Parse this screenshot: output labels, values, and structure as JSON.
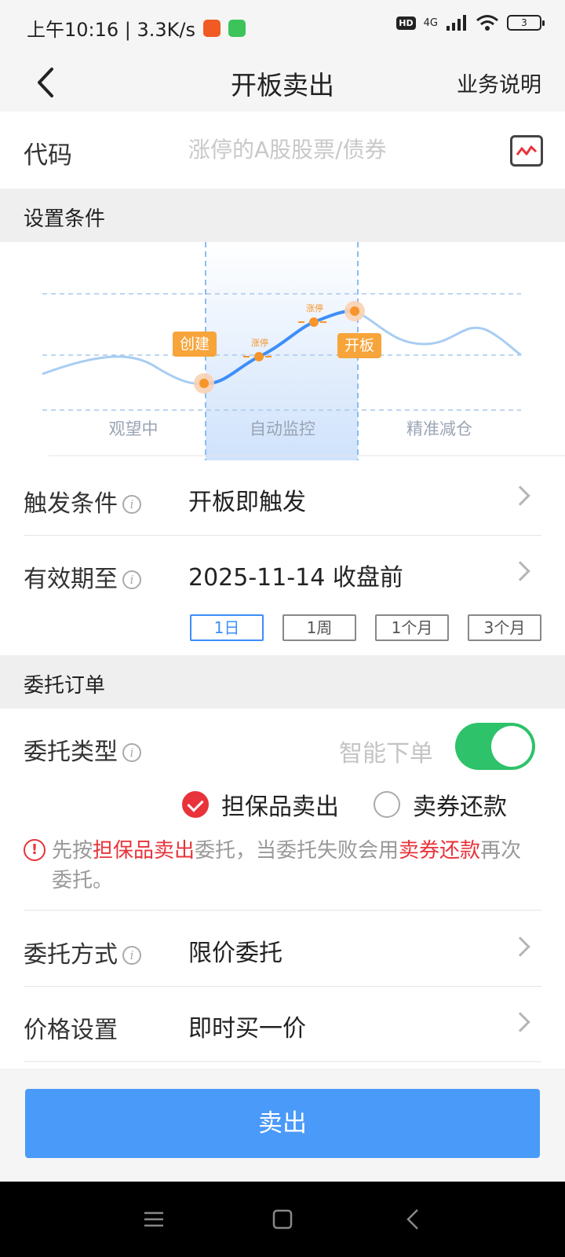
{
  "status_bar": {
    "time_speed": "上午10:16 | 3.3K/s",
    "network": "4G",
    "hd": "HD",
    "battery": "3"
  },
  "nav": {
    "title": "开板卖出",
    "help": "业务说明"
  },
  "code": {
    "label": "代码",
    "placeholder": "涨停的A股股票/债券"
  },
  "sections": {
    "conditions": "设置条件",
    "order": "委托订单"
  },
  "diagram": {
    "phases": [
      "观望中",
      "自动监控",
      "精准减仓"
    ],
    "tags": {
      "create": "创建",
      "limit_up_1": "涨停",
      "limit_up_2": "涨停",
      "open_board": "开板"
    }
  },
  "trigger": {
    "label": "触发条件",
    "value": "开板即触发"
  },
  "validity": {
    "label": "有效期至",
    "value": "2025-11-14 收盘前",
    "periods": [
      "1日",
      "1周",
      "1个月",
      "3个月"
    ],
    "selected": "1日"
  },
  "order_type": {
    "label": "委托类型",
    "smart_label": "智能下单",
    "smart_on": true,
    "options": [
      "担保品卖出",
      "卖券还款"
    ],
    "selected": "担保品卖出"
  },
  "notice": {
    "p1": "先按",
    "hl1": "担保品卖出",
    "p2": "委托，当委托失败会用",
    "hl2": "卖券还款",
    "p3": "再次委托。"
  },
  "method": {
    "label": "委托方式",
    "value": "限价委托"
  },
  "price": {
    "label": "价格设置",
    "value": "即时买一价"
  },
  "actions": {
    "sell": "卖出"
  },
  "colors": {
    "accent_blue": "#4a9af9",
    "toggle_green": "#2ec26a",
    "warning_red": "#e8333a",
    "tag_orange": "#f7a43a"
  }
}
